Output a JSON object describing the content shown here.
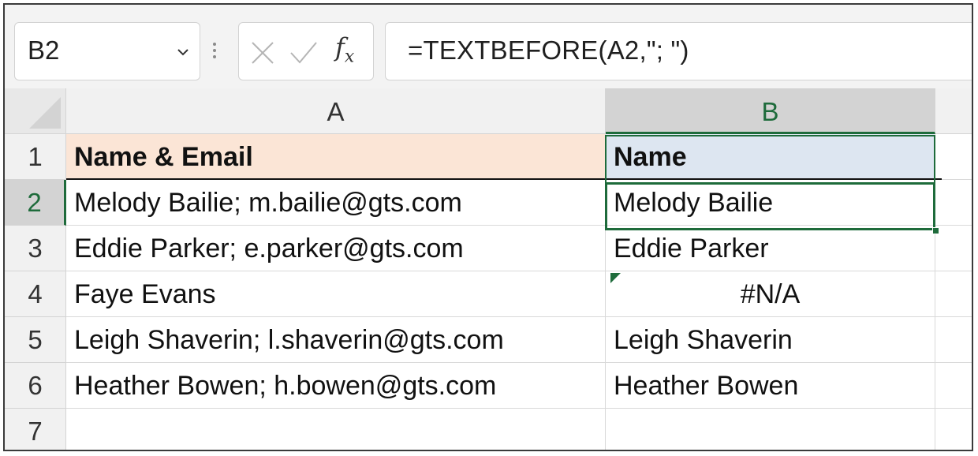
{
  "formula_bar": {
    "name_box": "B2",
    "cancel_icon": "close-icon",
    "enter_icon": "check-icon",
    "fx_label": "fx",
    "formula": "=TEXTBEFORE(A2,\"; \")"
  },
  "columns": [
    "A",
    "B"
  ],
  "rows": [
    {
      "num": "1",
      "a": "Name & Email",
      "b": "Name"
    },
    {
      "num": "2",
      "a": "Melody Bailie; m.bailie@gts.com",
      "b": "Melody Bailie"
    },
    {
      "num": "3",
      "a": "Eddie Parker; e.parker@gts.com",
      "b": "Eddie Parker"
    },
    {
      "num": "4",
      "a": "Faye Evans",
      "b": "#N/A"
    },
    {
      "num": "5",
      "a": "Leigh Shaverin; l.shaverin@gts.com",
      "b": "Leigh Shaverin"
    },
    {
      "num": "6",
      "a": "Heather Bowen; h.bowen@gts.com",
      "b": "Heather Bowen"
    },
    {
      "num": "7",
      "a": "",
      "b": ""
    }
  ],
  "active_cell": "B2",
  "colors": {
    "header_a_fill": "#fbe5d6",
    "header_b_fill": "#dde6f1",
    "selection": "#1e6b3b"
  }
}
